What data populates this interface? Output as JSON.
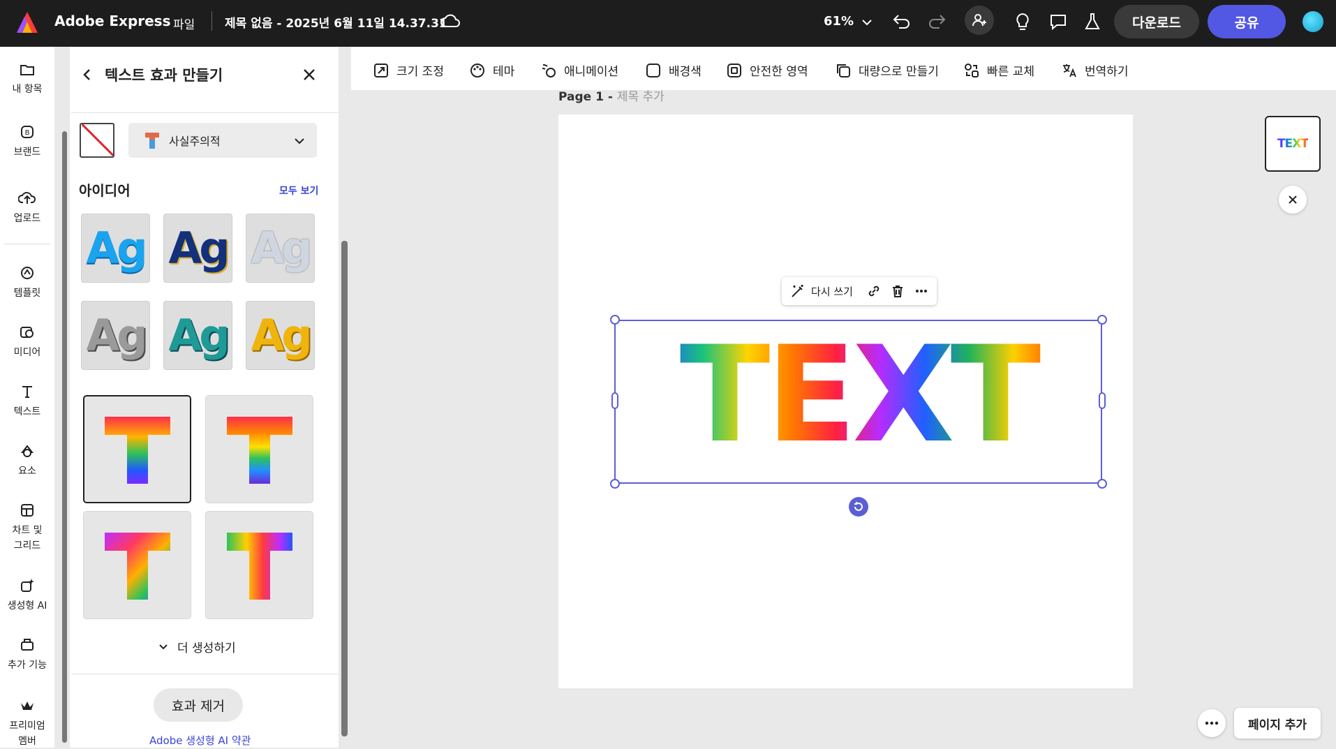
{
  "app": {
    "name": "Adobe Express",
    "file_menu": "파일",
    "doc_title": "제목 없음 - 2025년 6월 11일 14.37.31",
    "zoom": "61%",
    "download_label": "다운로드",
    "share_label": "공유",
    "accent": "#5258e4"
  },
  "rail": {
    "items": [
      {
        "label": "내 항목",
        "icon": "folder-icon"
      },
      {
        "label": "브랜드",
        "icon": "brand-icon"
      },
      {
        "label": "업로드",
        "icon": "upload-icon"
      },
      {
        "label": "템플릿",
        "icon": "template-icon"
      },
      {
        "label": "미디어",
        "icon": "media-icon"
      },
      {
        "label": "텍스트",
        "icon": "text-icon"
      },
      {
        "label": "요소",
        "icon": "elements-icon"
      },
      {
        "label": "차트 및 그리드",
        "icon": "chart-grid-icon"
      },
      {
        "label": "생성형 AI",
        "icon": "generative-ai-icon"
      },
      {
        "label": "추가 기능",
        "icon": "addons-icon"
      },
      {
        "label": "프리미엄 멤버",
        "icon": "premium-icon"
      }
    ]
  },
  "panel": {
    "title": "텍스트 효과 만들기",
    "style_label": "사실주의적",
    "ideas_title": "아이디어",
    "see_all": "모두 보기",
    "idea_tiles": [
      {
        "text": "Ag",
        "style": "blue-gloss"
      },
      {
        "text": "Ag",
        "style": "gold-navy"
      },
      {
        "text": "Ag",
        "style": "ice"
      },
      {
        "text": "Ag",
        "style": "silver"
      },
      {
        "text": "Ag",
        "style": "teal-ice"
      },
      {
        "text": "Ag",
        "style": "gold"
      }
    ],
    "generated_letter": "T",
    "more_generate": "더 생성하기",
    "remove_effect": "효과 제거",
    "terms": "Adobe 생성형 AI 약관"
  },
  "toolbar": {
    "items": [
      {
        "label": "크기 조정",
        "icon": "resize-icon"
      },
      {
        "label": "테마",
        "icon": "theme-icon"
      },
      {
        "label": "애니메이션",
        "icon": "animation-icon"
      },
      {
        "label": "배경색",
        "icon": "background-color-icon"
      },
      {
        "label": "안전한 영역",
        "icon": "safe-area-icon"
      },
      {
        "label": "대량으로 만들기",
        "icon": "bulk-create-icon"
      },
      {
        "label": "빠른 교체",
        "icon": "quick-swap-icon"
      },
      {
        "label": "번역하기",
        "icon": "translate-icon"
      }
    ]
  },
  "canvas": {
    "page_label": "Page 1 - ",
    "page_sub": "제목 추가",
    "text_content": "TEXT",
    "rewrite_label": "다시 쓰기",
    "thumb_text": "TEXT",
    "add_page": "페이지 추가"
  }
}
